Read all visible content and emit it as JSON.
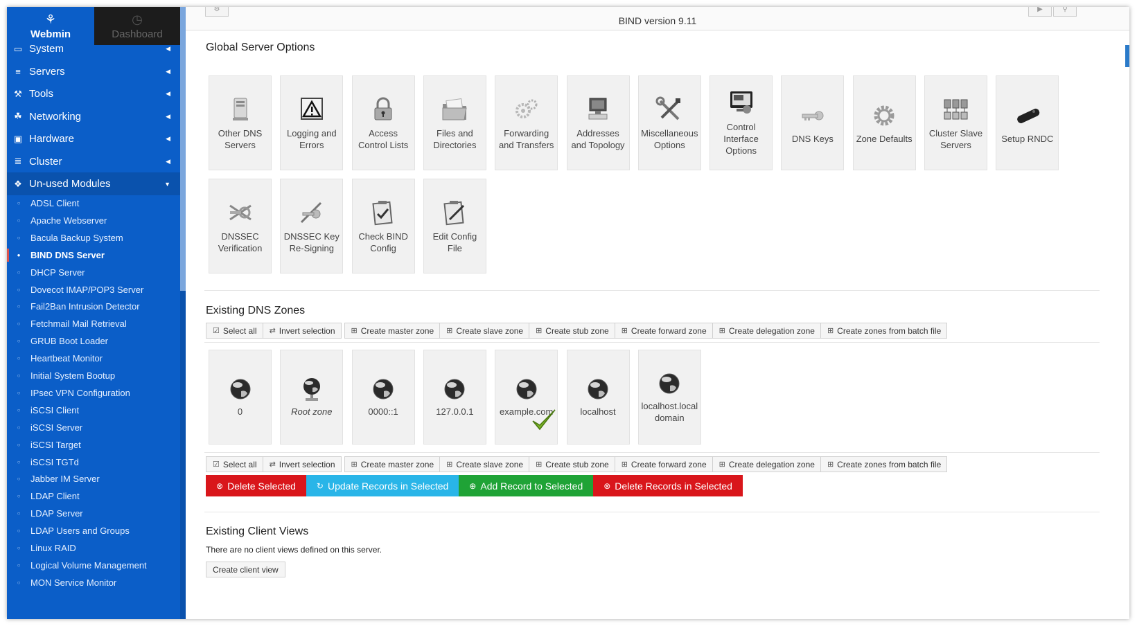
{
  "sidebar": {
    "brand_icon": "webmin-logo-icon",
    "brand_label": "Webmin",
    "dashboard_icon": "dashboard-icon",
    "dashboard_label": "Dashboard",
    "categories": [
      {
        "label": "System",
        "icon": "laptop-icon"
      },
      {
        "label": "Servers",
        "icon": "rack-icon"
      },
      {
        "label": "Tools",
        "icon": "tools-icon"
      },
      {
        "label": "Networking",
        "icon": "network-icon"
      },
      {
        "label": "Hardware",
        "icon": "hdd-icon"
      },
      {
        "label": "Cluster",
        "icon": "layers-icon"
      },
      {
        "label": "Un-used Modules",
        "icon": "puzzle-icon"
      }
    ],
    "modules": [
      "ADSL Client",
      "Apache Webserver",
      "Bacula Backup System",
      "BIND DNS Server",
      "DHCP Server",
      "Dovecot IMAP/POP3 Server",
      "Fail2Ban Intrusion Detector",
      "Fetchmail Mail Retrieval",
      "GRUB Boot Loader",
      "Heartbeat Monitor",
      "Initial System Bootup",
      "IPsec VPN Configuration",
      "iSCSI Client",
      "iSCSI Server",
      "iSCSI Target",
      "iSCSI TGTd",
      "Jabber IM Server",
      "LDAP Client",
      "LDAP Server",
      "LDAP Users and Groups",
      "Linux RAID",
      "Logical Volume Management",
      "MON Service Monitor"
    ],
    "active_module": "BIND DNS Server"
  },
  "header": {
    "title": "BIND version 9.11"
  },
  "global_options": {
    "heading": "Global Server Options",
    "tiles": [
      {
        "label": "Other DNS Servers",
        "icon": "server-icon"
      },
      {
        "label": "Logging and Errors",
        "icon": "warning-icon"
      },
      {
        "label": "Access Control Lists",
        "icon": "padlock-icon"
      },
      {
        "label": "Files and Directories",
        "icon": "folder-icon"
      },
      {
        "label": "Forwarding and Transfers",
        "icon": "gears-icon"
      },
      {
        "label": "Addresses and Topology",
        "icon": "computer-icon"
      },
      {
        "label": "Miscellaneous Options",
        "icon": "tools-icon"
      },
      {
        "label": "Control Interface Options",
        "icon": "monitor-icon"
      },
      {
        "label": "DNS Keys",
        "icon": "key-icon"
      },
      {
        "label": "Zone Defaults",
        "icon": "gear-icon"
      },
      {
        "label": "Cluster Slave Servers",
        "icon": "cluster-icon"
      },
      {
        "label": "Setup RNDC",
        "icon": "remote-icon"
      },
      {
        "label": "DNSSEC Verification",
        "icon": "dnssec-icon"
      },
      {
        "label": "DNSSEC Key Re-Signing",
        "icon": "pen-key-icon"
      },
      {
        "label": "Check BIND Config",
        "icon": "clipboard-check-icon"
      },
      {
        "label": "Edit Config File",
        "icon": "clipboard-edit-icon"
      }
    ]
  },
  "zones": {
    "heading": "Existing DNS Zones",
    "toolbar": [
      {
        "label": "Select all",
        "icon": "check-square-icon"
      },
      {
        "label": "Invert selection",
        "icon": "invert-icon"
      },
      {
        "label": "Create master zone",
        "icon": "plus-square-icon"
      },
      {
        "label": "Create slave zone",
        "icon": "plus-square-icon"
      },
      {
        "label": "Create stub zone",
        "icon": "plus-square-icon"
      },
      {
        "label": "Create forward zone",
        "icon": "plus-square-icon"
      },
      {
        "label": "Create delegation zone",
        "icon": "plus-square-icon"
      },
      {
        "label": "Create zones from batch file",
        "icon": "plus-square-icon"
      }
    ],
    "items": [
      {
        "label": "0",
        "icon": "globe-icon"
      },
      {
        "label": "Root zone",
        "icon": "globe-network-icon"
      },
      {
        "label": "0000::1",
        "icon": "globe-icon"
      },
      {
        "label": "127.0.0.1",
        "icon": "globe-icon"
      },
      {
        "label": "example.com",
        "icon": "globe-icon",
        "selected": true
      },
      {
        "label": "localhost",
        "icon": "globe-icon"
      },
      {
        "label": "localhost.localdomain",
        "icon": "globe-icon"
      }
    ],
    "actions": [
      {
        "label": "Delete Selected",
        "icon": "times-circle-icon",
        "color": "#d9161b"
      },
      {
        "label": "Update Records in Selected",
        "icon": "refresh-icon",
        "color": "#29b5e8"
      },
      {
        "label": "Add Record to Selected",
        "icon": "plus-circle-icon",
        "color": "#1fa336"
      },
      {
        "label": "Delete Records in Selected",
        "icon": "times-circle-icon",
        "color": "#d9161b"
      }
    ]
  },
  "views": {
    "heading": "Existing Client Views",
    "empty_text": "There are no client views defined on this server.",
    "create_label": "Create client view"
  }
}
